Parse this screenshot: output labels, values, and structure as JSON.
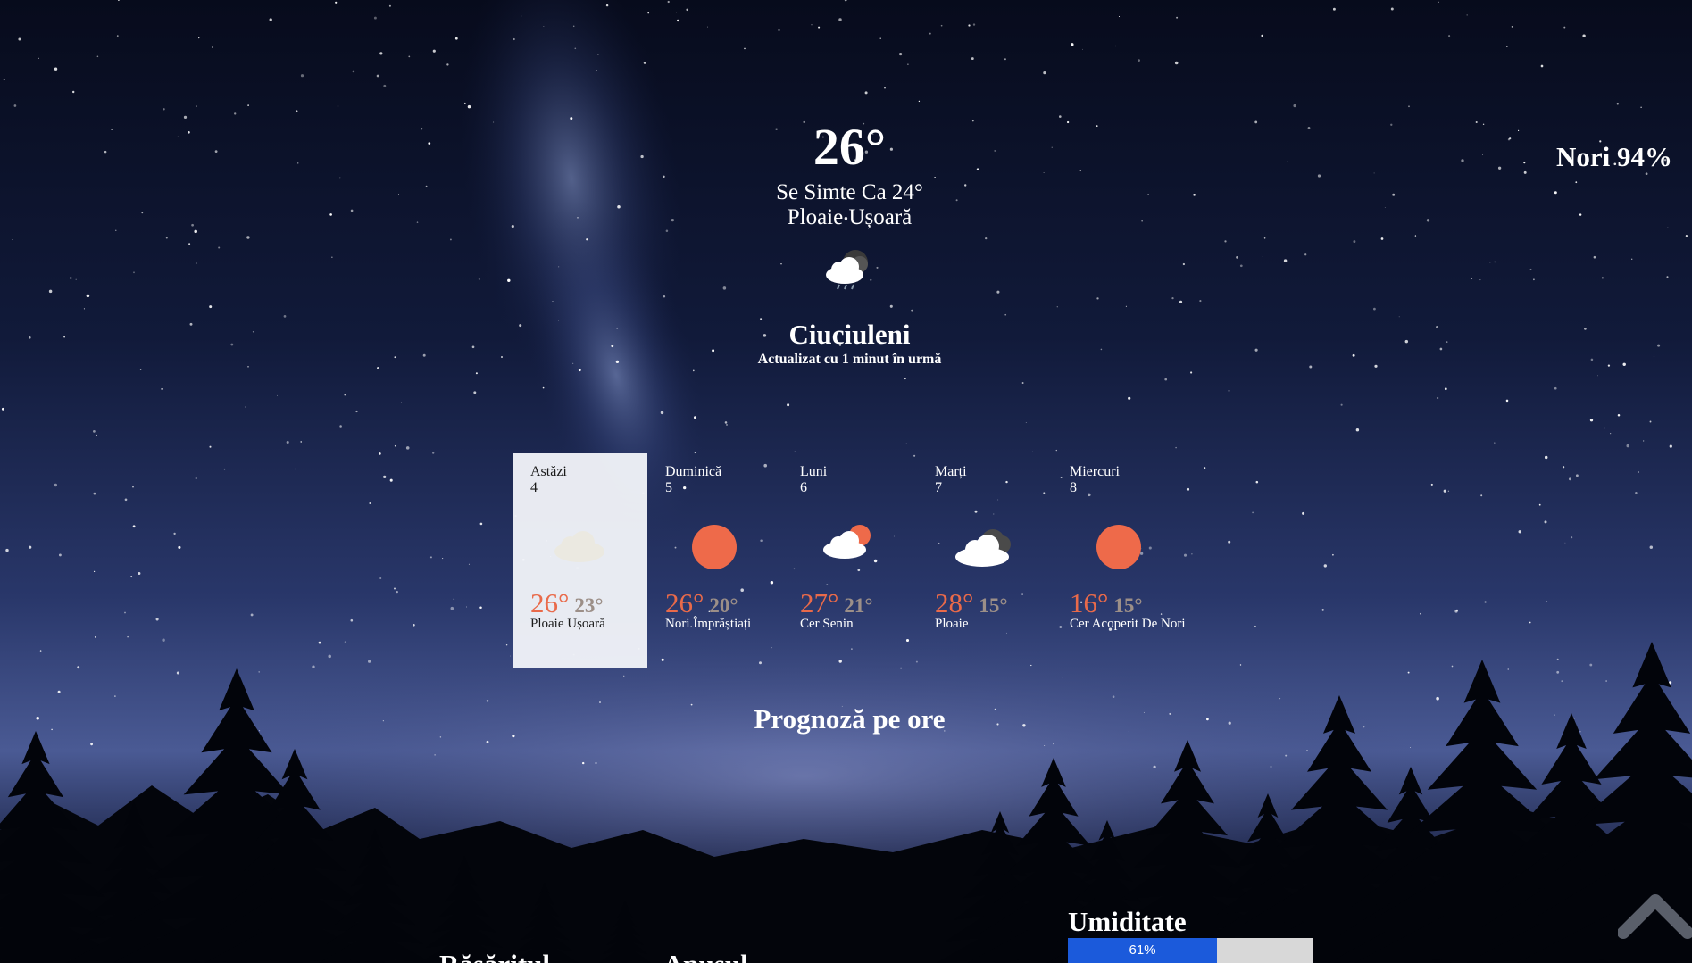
{
  "current": {
    "temperature": "26°",
    "feels_like": "Se Simte Ca 24°",
    "description": "Ploaie Ușoară",
    "icon": "light-rain-night-cloud-icon",
    "city": "Ciuciuleni",
    "updated": "Actualizat cu 1 minut în urmă",
    "clouds": "Nori 94%"
  },
  "daily": [
    {
      "day": "Astăzi",
      "date": "4",
      "max": "26°",
      "min": "23°",
      "description": "Ploaie Ușoară",
      "icon": "cloud-icon",
      "active": true
    },
    {
      "day": "Duminică",
      "date": "5",
      "max": "26°",
      "min": "20°",
      "description": "Nori Împrăștiați",
      "icon": "sun-icon",
      "active": false
    },
    {
      "day": "Luni",
      "date": "6",
      "max": "27°",
      "min": "21°",
      "description": "Cer Senin",
      "icon": "sun-cloud-icon",
      "active": false
    },
    {
      "day": "Marți",
      "date": "7",
      "max": "28°",
      "min": "15°",
      "description": "Ploaie",
      "icon": "dark-cloud-icon",
      "active": false
    },
    {
      "day": "Miercuri",
      "date": "8",
      "max": "16°",
      "min": "15°",
      "description": "Cer Acoperit De Nori",
      "icon": "sun-icon",
      "active": false
    }
  ],
  "hourly": {
    "title": "Prognoză pe ore"
  },
  "sun": {
    "sunrise_title": "Răsăritul",
    "sunset_title": "Apusul"
  },
  "humidity": {
    "title": "Umiditate",
    "value": 61,
    "label": "61%"
  },
  "scroll_top": {
    "icon": "chevron-up-icon"
  },
  "colors": {
    "temp_max": "#e96a4a",
    "temp_min": "#9c8f88",
    "sun": "#ee6a4a",
    "humidity_fill": "#1b5adb",
    "humidity_track": "#d8d8d8",
    "active_card": "#f0f3f8"
  }
}
